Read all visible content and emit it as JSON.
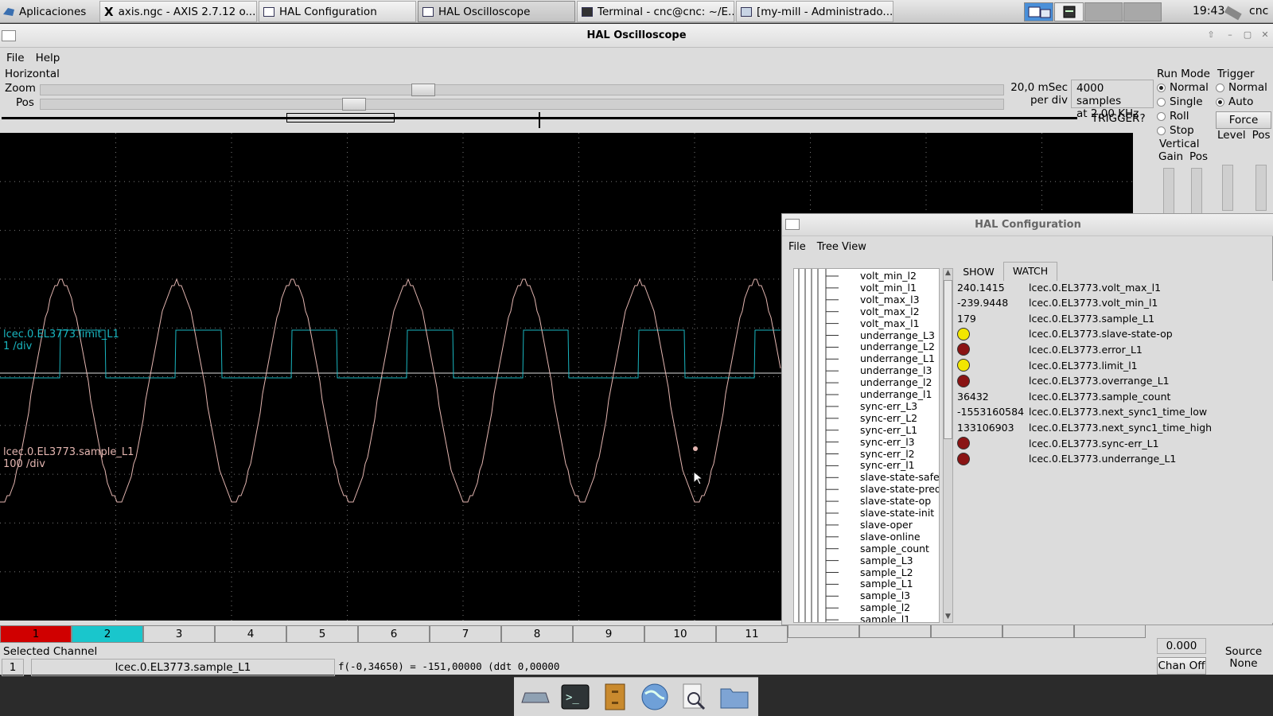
{
  "taskbar": {
    "apps_menu": "Aplicaciones",
    "tasks": [
      {
        "label": "axis.ngc - AXIS 2.7.12 o...",
        "icon": "x-icon"
      },
      {
        "label": "HAL Configuration",
        "icon": "window-icon"
      },
      {
        "label": "HAL Oscilloscope",
        "icon": "window-icon"
      },
      {
        "label": "Terminal - cnc@cnc: ~/E...",
        "icon": "terminal-icon"
      },
      {
        "label": "[my-mill - Administrado...",
        "icon": "folder-icon"
      }
    ],
    "clock": "19:43",
    "user": "cnc"
  },
  "scope": {
    "title": "HAL Oscilloscope",
    "menu": [
      "File",
      "Help"
    ],
    "horizontal": {
      "label": "Horizontal",
      "zoom_label": "Zoom",
      "pos_label": "Pos",
      "zoom_value": 0.395,
      "pos_value": 0.321,
      "rate_line1": "20,0 mSec",
      "rate_line2": "per div",
      "samples_line1": "4000 samples",
      "samples_line2": "at 2,00 KHz",
      "trigger_status": "TRIGGER?"
    },
    "run_mode": {
      "label": "Run Mode",
      "options": [
        "Normal",
        "Single",
        "Roll",
        "Stop"
      ],
      "selected": "Normal"
    },
    "trigger": {
      "label": "Trigger",
      "options": [
        "Normal",
        "Auto"
      ],
      "selected": "Auto",
      "force": "Force",
      "level": "Level",
      "pos": "Pos"
    },
    "vertical": {
      "label": "Vertical",
      "gain": "Gain",
      "pos": "Pos"
    },
    "traces": [
      {
        "name": "lcec.0.EL3773.limit_L1",
        "scale": "1 /div",
        "color": "#19b6c0"
      },
      {
        "name": "lcec.0.EL3773.sample_L1",
        "scale": "100 /div",
        "color": "#e3b5b0"
      }
    ],
    "channels": [
      "1",
      "2",
      "3",
      "4",
      "5",
      "6",
      "7",
      "8",
      "9",
      "10",
      "11"
    ],
    "channel_colors": {
      "1": "#d00000",
      "2": "#19c6cc"
    },
    "selected_channel": {
      "label": "Selected Channel",
      "number": "1",
      "name": "lcec.0.EL3773.sample_L1",
      "readout": "f(-0,34650) = -151,00000 (ddt  0,00000"
    },
    "offset_value": "0.000",
    "chan_off": "Chan Off",
    "source_label": "Source",
    "source_value": "None"
  },
  "halconfig": {
    "title": "HAL Configuration",
    "menu": [
      "File",
      "Tree View"
    ],
    "tabs": [
      "SHOW",
      "WATCH"
    ],
    "active_tab": "WATCH",
    "tree_items": [
      "volt_min_l2",
      "volt_min_l1",
      "volt_max_l3",
      "volt_max_l2",
      "volt_max_l1",
      "underrange_L3",
      "underrange_L2",
      "underrange_L1",
      "underrange_l3",
      "underrange_l2",
      "underrange_l1",
      "sync-err_L3",
      "sync-err_L2",
      "sync-err_L1",
      "sync-err_l3",
      "sync-err_l2",
      "sync-err_l1",
      "slave-state-safeop",
      "slave-state-preop",
      "slave-state-op",
      "slave-state-init",
      "slave-oper",
      "slave-online",
      "sample_count",
      "sample_L3",
      "sample_L2",
      "sample_L1",
      "sample_l3",
      "sample_l2",
      "sample_l1"
    ],
    "watch": [
      {
        "value": "240.1415",
        "led": null,
        "name": "lcec.0.EL3773.volt_max_l1"
      },
      {
        "value": "-239.9448",
        "led": null,
        "name": "lcec.0.EL3773.volt_min_l1"
      },
      {
        "value": "179",
        "led": null,
        "name": "lcec.0.EL3773.sample_L1"
      },
      {
        "value": "",
        "led": "#f2e600",
        "name": "lcec.0.EL3773.slave-state-op"
      },
      {
        "value": "",
        "led": "#8a1414",
        "name": "lcec.0.EL3773.error_L1"
      },
      {
        "value": "",
        "led": "#f2e600",
        "name": "lcec.0.EL3773.limit_l1"
      },
      {
        "value": "",
        "led": "#8a1414",
        "name": "lcec.0.EL3773.overrange_L1"
      },
      {
        "value": "36432",
        "led": null,
        "name": "lcec.0.EL3773.sample_count"
      },
      {
        "value": "-1553160584",
        "led": null,
        "name": "lcec.0.EL3773.next_sync1_time_low"
      },
      {
        "value": "133106903",
        "led": null,
        "name": "lcec.0.EL3773.next_sync1_time_high"
      },
      {
        "value": "",
        "led": "#8a1414",
        "name": "lcec.0.EL3773.sync-err_L1"
      },
      {
        "value": "",
        "led": "#8a1414",
        "name": "lcec.0.EL3773.underrange_L1"
      }
    ]
  },
  "dock": {
    "icons": [
      "drive-icon",
      "terminal-icon",
      "file-cabinet-icon",
      "globe-icon",
      "magnifier-icon",
      "folder-icon"
    ]
  }
}
